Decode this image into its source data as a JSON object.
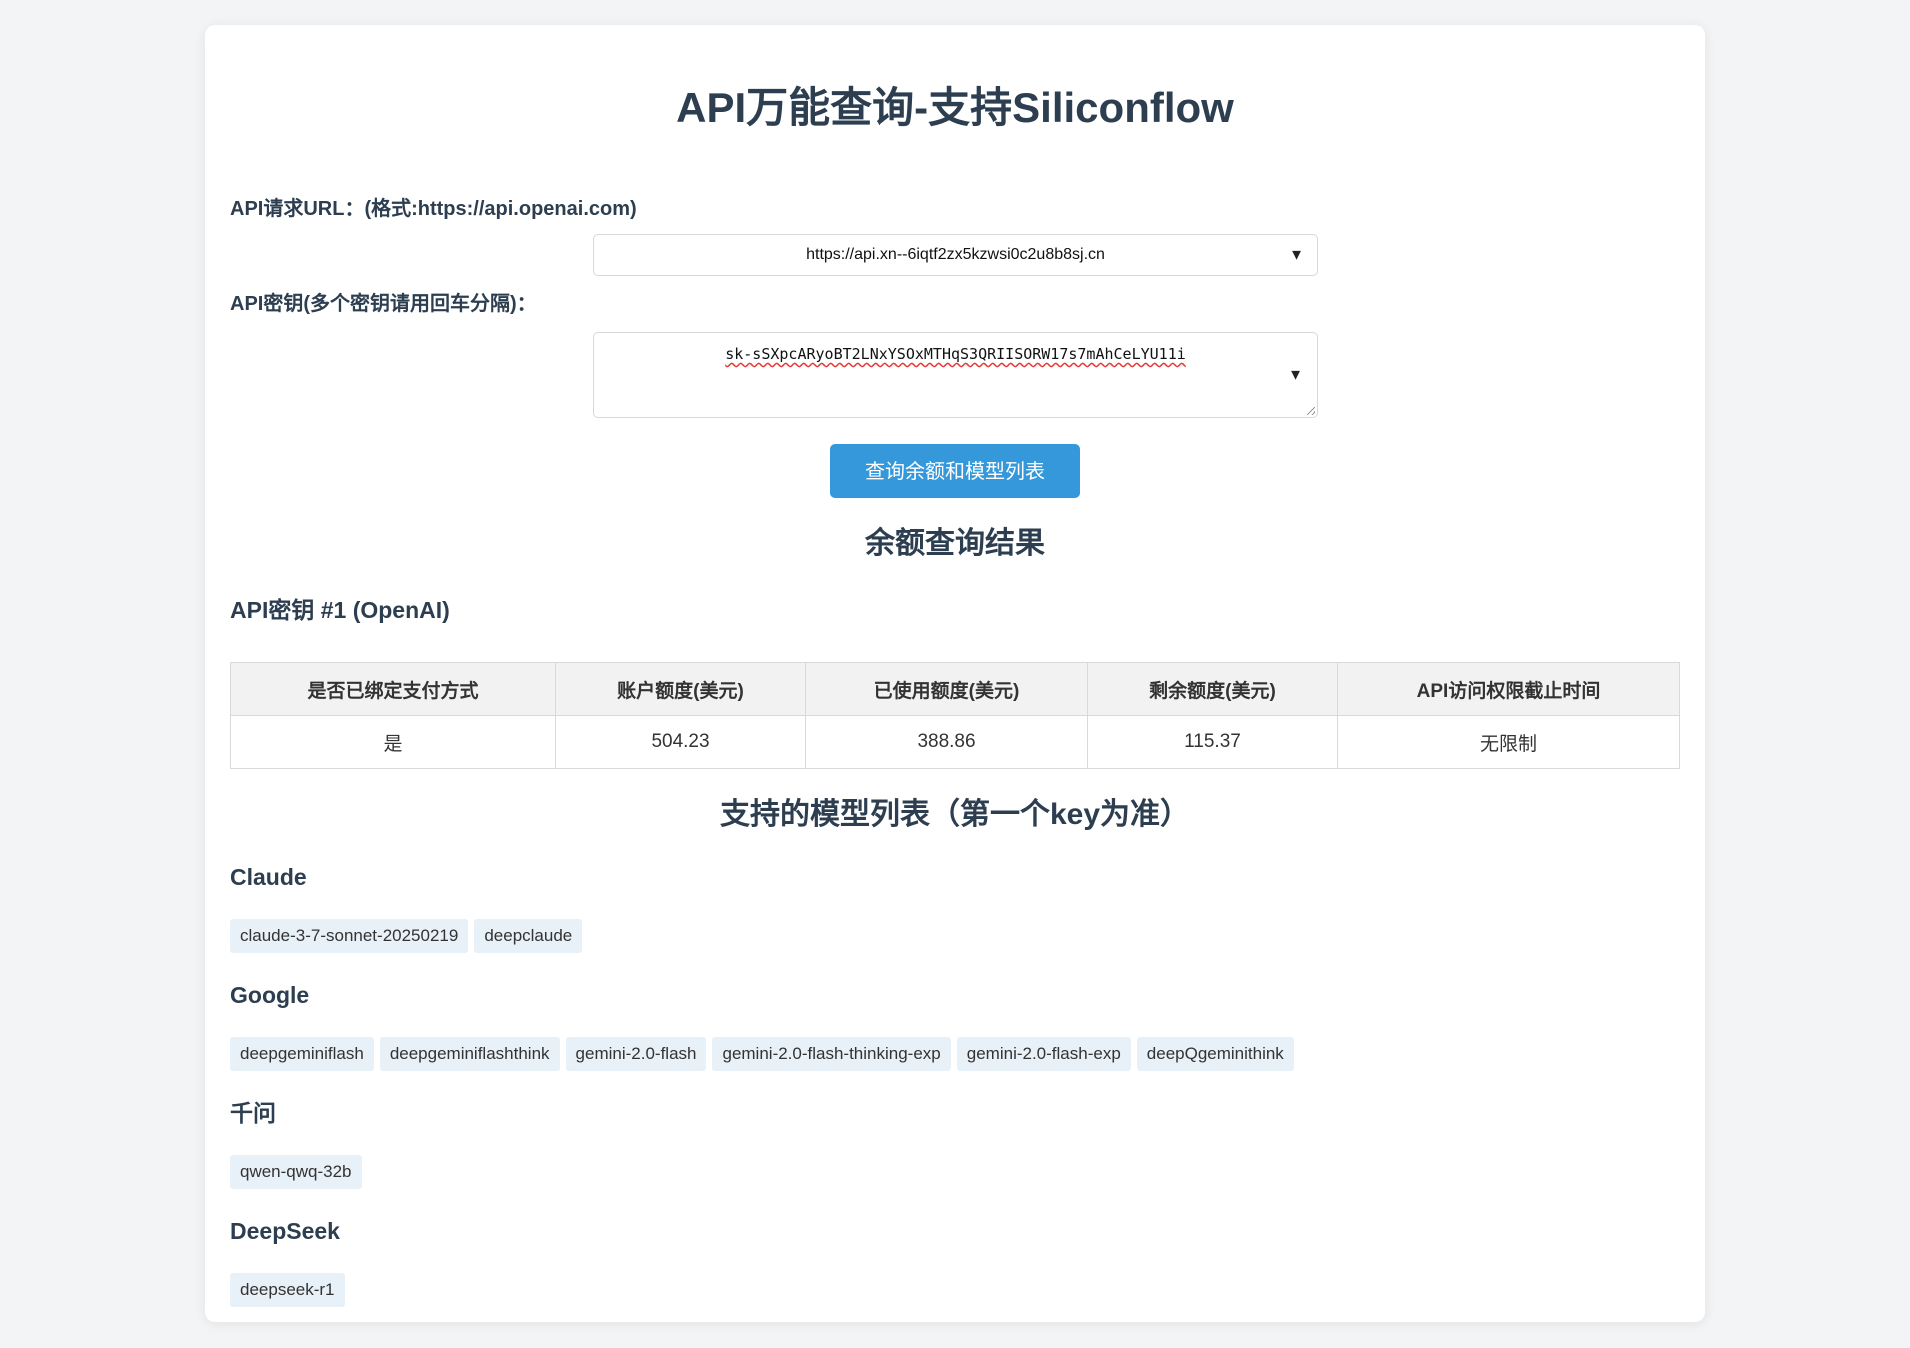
{
  "page": {
    "title": "API万能查询-支持Siliconflow"
  },
  "form": {
    "url_label": "API请求URL：(格式:https://api.openai.com)",
    "url_value": "https://api.xn--6iqtf2zx5kzwsi0c2u8b8sj.cn",
    "key_label": "API密钥(多个密钥请用回车分隔)：",
    "key_value": "sk-sSXpcARyoBT2LNxYSOxMTHqS3QRIISORW17s7mAhCeLYU11i",
    "submit_label": "查询余额和模型列表"
  },
  "balance": {
    "section_title": "余额查询结果",
    "key_heading": "API密钥 #1 (OpenAI)",
    "columns": [
      "是否已绑定支付方式",
      "账户额度(美元)",
      "已使用额度(美元)",
      "剩余额度(美元)",
      "API访问权限截止时间"
    ],
    "rows": [
      [
        "是",
        "504.23",
        "388.86",
        "115.37",
        "无限制"
      ]
    ]
  },
  "models": {
    "section_title": "支持的模型列表（第一个key为准）",
    "groups": [
      {
        "name": "Claude",
        "items": [
          "claude-3-7-sonnet-20250219",
          "deepclaude"
        ]
      },
      {
        "name": "Google",
        "items": [
          "deepgeminiflash",
          "deepgeminiflashthink",
          "gemini-2.0-flash",
          "gemini-2.0-flash-thinking-exp",
          "gemini-2.0-flash-exp",
          "deepQgeminithink"
        ]
      },
      {
        "name": "千问",
        "items": [
          "qwen-qwq-32b"
        ]
      },
      {
        "name": "DeepSeek",
        "items": [
          "deepseek-r1"
        ]
      }
    ]
  },
  "colors": {
    "accent": "#3498db",
    "heading": "#2c3e50",
    "tag_bg": "#e8f0f8"
  }
}
